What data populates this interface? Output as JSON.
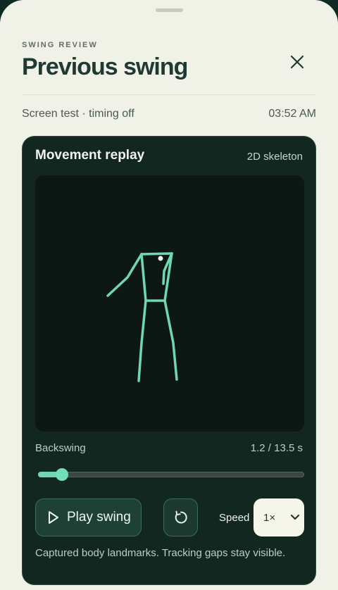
{
  "header": {
    "eyebrow": "SWING REVIEW",
    "title": "Previous swing",
    "close_icon": "close-icon"
  },
  "meta": {
    "status": "Screen test · timing off",
    "timestamp": "03:52 AM"
  },
  "replay": {
    "title": "Movement replay",
    "mode": "2D skeleton",
    "phase": "Backswing",
    "time": "1.2 / 13.5 s",
    "progress": 0.089,
    "play_label": "Play swing",
    "play_icon": "play-icon",
    "reset_icon": "restart-icon",
    "speed_label": "Speed",
    "speed_value": "1×",
    "note": "Captured body landmarks. Tracking gaps stay visible."
  },
  "colors": {
    "sheet": "#f0f1e7",
    "card": "#12271f",
    "accent": "#72dfba",
    "title": "#1f3a32"
  }
}
